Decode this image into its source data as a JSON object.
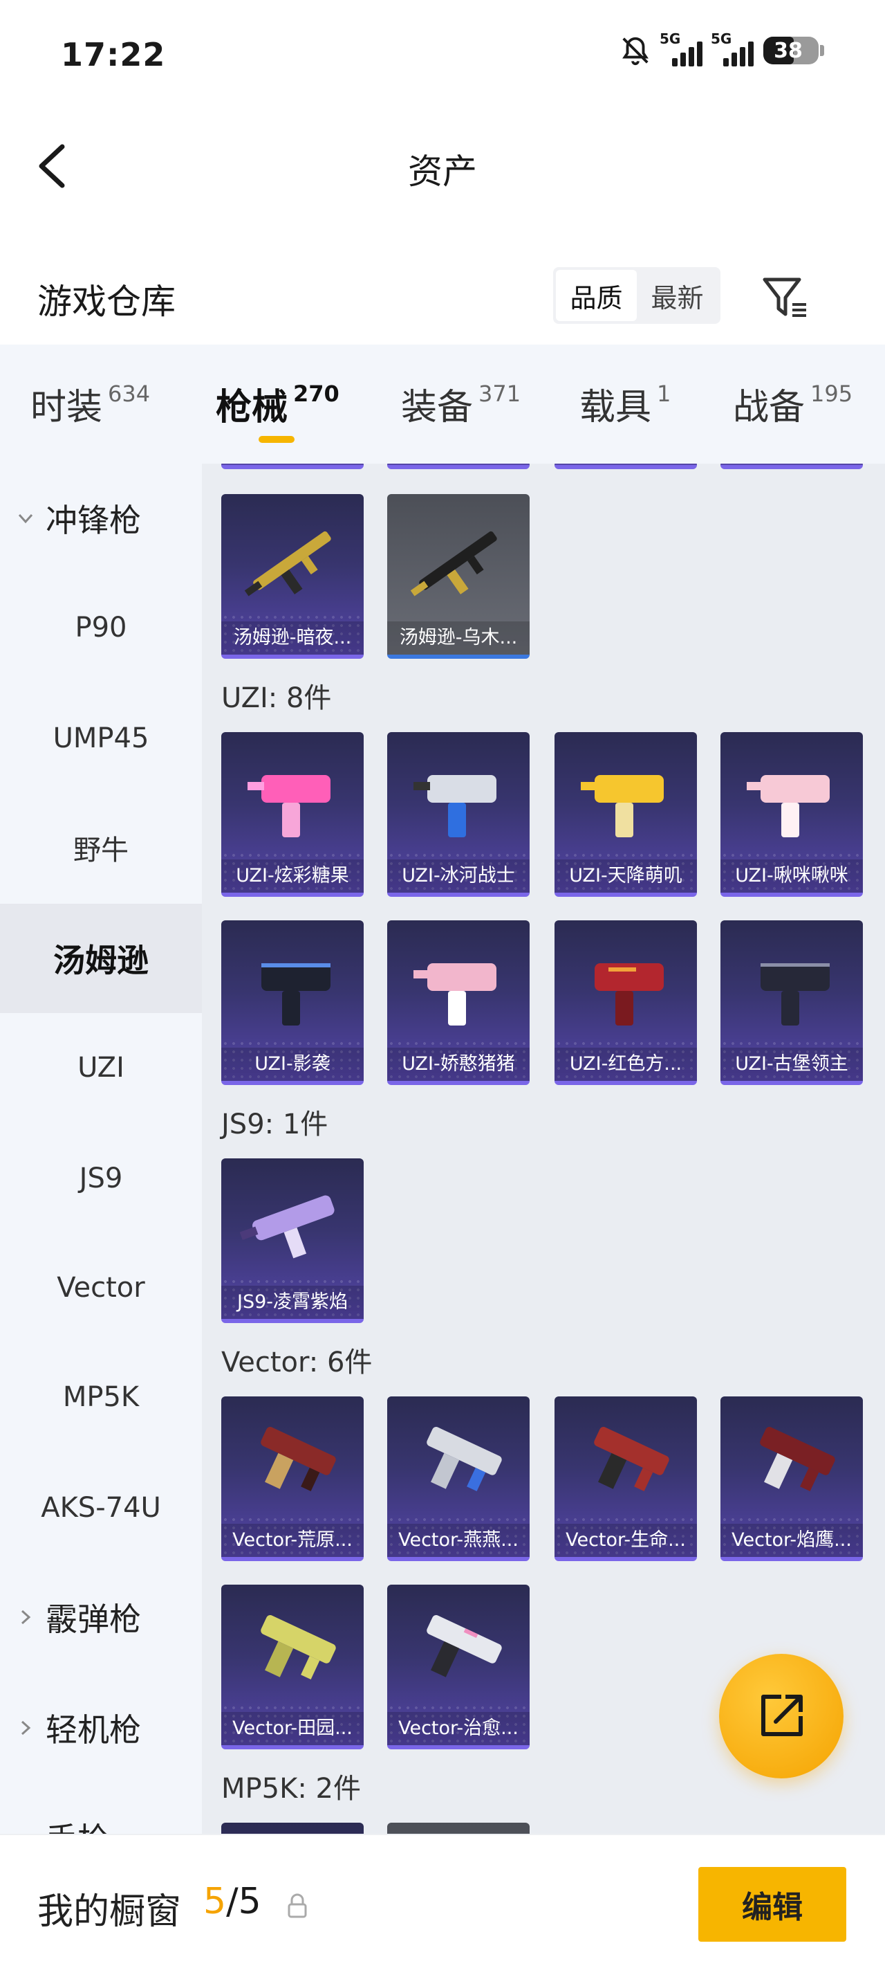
{
  "status_bar": {
    "time": "17:22",
    "network_1": "5G",
    "network_2": "5G",
    "battery_level": "38"
  },
  "header": {
    "title": "资产"
  },
  "warehouse": {
    "title": "游戏仓库",
    "sort_options": [
      "品质",
      "最新"
    ],
    "sort_selected": "品质"
  },
  "tabs": [
    {
      "label": "时装",
      "count": "634"
    },
    {
      "label": "枪械",
      "count": "270",
      "active": true
    },
    {
      "label": "装备",
      "count": "371"
    },
    {
      "label": "载具",
      "count": "1"
    },
    {
      "label": "战备",
      "count": "195"
    }
  ],
  "sidebar": {
    "group_smg": "冲锋枪",
    "items": [
      "P90",
      "UMP45",
      "野牛",
      "汤姆逊",
      "UZI",
      "JS9",
      "Vector",
      "MP5K",
      "AKS-74U"
    ],
    "active_item": "汤姆逊",
    "group_shotgun": "霰弹枪",
    "group_lmg": "轻机枪",
    "group_pistol_partial": "手枪"
  },
  "content": {
    "thompson_cards": [
      "汤姆逊-暗夜...",
      "汤姆逊-乌木..."
    ],
    "uzi_label": "UZI: 8件",
    "uzi_cards": [
      "UZI-炫彩糖果",
      "UZI-冰河战士",
      "UZI-天降萌叽",
      "UZI-啾咪啾咪",
      "UZI-影袭",
      "UZI-娇憨猪猪",
      "UZI-红色方...",
      "UZI-古堡领主"
    ],
    "js9_label": "JS9: 1件",
    "js9_cards": [
      "JS9-凌霄紫焰"
    ],
    "vector_label": "Vector: 6件",
    "vector_cards": [
      "Vector-荒原...",
      "Vector-燕燕...",
      "Vector-生命...",
      "Vector-焰鹰...",
      "Vector-田园...",
      "Vector-治愈..."
    ],
    "mp5k_label": "MP5K: 2件"
  },
  "bottom": {
    "showcase_label": "我的橱窗",
    "showcase_current": "5",
    "showcase_total": "/5",
    "edit_label": "编辑"
  },
  "colors": {
    "accent": "#f7b500",
    "card_purple": "#5445a8",
    "card_border": "#7a66e8"
  }
}
